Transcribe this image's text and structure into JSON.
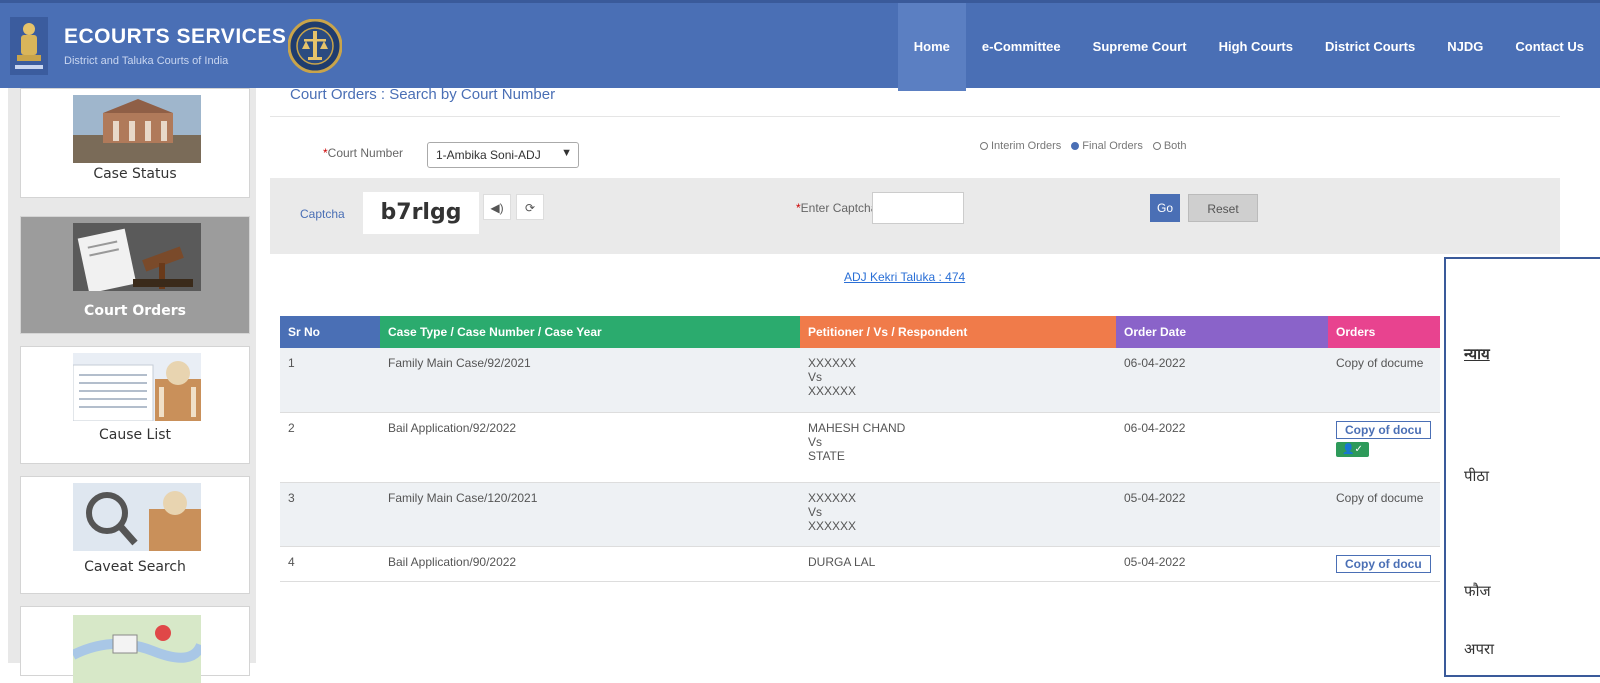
{
  "header": {
    "brand_title": "ECOURTS SERVICES",
    "brand_subtitle": "District and Taluka Courts of India",
    "nav": [
      "Home",
      "e-Committee",
      "Supreme Court",
      "High Courts",
      "District Courts",
      "NJDG",
      "Contact Us"
    ],
    "active_nav": "Home",
    "color": "#4a6fb5"
  },
  "sidebar": {
    "items": [
      {
        "label": "Case Status",
        "icon": "court-building-thumb"
      },
      {
        "label": "Court Orders",
        "icon": "gavel-document-thumb"
      },
      {
        "label": "Cause List",
        "icon": "list-court-thumb"
      },
      {
        "label": "Caveat Search",
        "icon": "magnifier-court-thumb"
      },
      {
        "label": "",
        "icon": "map-pin-thumb"
      }
    ],
    "active": "Court Orders"
  },
  "main": {
    "title": "Court Orders : Search by Court Number",
    "court_number_label": "Court Number",
    "court_number_value": "1-Ambika Soni-ADJ",
    "radios": [
      {
        "label": "Interim Orders",
        "checked": false
      },
      {
        "label": "Final Orders",
        "checked": true
      },
      {
        "label": "Both",
        "checked": false
      }
    ],
    "captcha_label": "Captcha",
    "captcha_text": "b7rlgg",
    "enter_captcha_label": "Enter Captcha",
    "go_label": "Go",
    "reset_label": "Reset",
    "court_link": "ADJ Kekri Taluka : 474"
  },
  "table": {
    "headers": [
      {
        "label": "Sr No",
        "color": "#4a6fb5"
      },
      {
        "label": "Case Type / Case Number / Case Year",
        "color": "#2bab6e"
      },
      {
        "label": "Petitioner / Vs / Respondent",
        "color": "#f07b4a"
      },
      {
        "label": "Order Date",
        "color": "#8a63c9"
      },
      {
        "label": "Orders",
        "color": "#e8438f"
      }
    ],
    "rows": [
      {
        "sr": "1",
        "case": "Family Main Case/92/2021",
        "petitioner": "XXXXXX",
        "vs": "Vs",
        "respondent": "XXXXXX",
        "date": "06-04-2022",
        "order": "Copy of docume"
      },
      {
        "sr": "2",
        "case": "Bail Application/92/2022",
        "petitioner": "MAHESH CHAND",
        "vs": "Vs",
        "respondent": "STATE",
        "date": "06-04-2022",
        "order": "Copy of docu"
      },
      {
        "sr": "3",
        "case": "Family Main Case/120/2021",
        "petitioner": "XXXXXX",
        "vs": "Vs",
        "respondent": "XXXXXX",
        "date": "05-04-2022",
        "order": "Copy of docume"
      },
      {
        "sr": "4",
        "case": "Bail Application/90/2022",
        "petitioner": "DURGA LAL",
        "vs": "",
        "respondent": "",
        "date": "05-04-2022",
        "order": "Copy of docu"
      }
    ]
  },
  "popup": {
    "lines": [
      "न्याय",
      "पीठा",
      "फौज",
      "अपरा"
    ]
  }
}
